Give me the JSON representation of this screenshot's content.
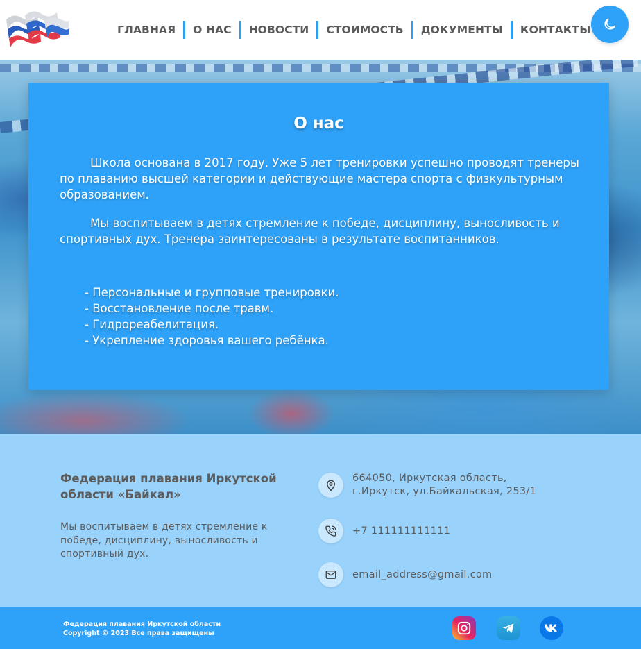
{
  "nav": {
    "items": [
      "ГЛАВНАЯ",
      "О НАС",
      "НОВОСТИ",
      "СТОИМОСТЬ",
      "ДОКУМЕНТЫ",
      "КОНТАКТЫ"
    ]
  },
  "icons": {
    "logo": "flag-logo-icon",
    "theme_toggle": "moon-icon",
    "address": "map-pin-icon",
    "phone": "phone-icon",
    "email": "mail-icon",
    "social": [
      "instagram-icon",
      "telegram-icon",
      "vk-icon"
    ]
  },
  "colors": {
    "accent": "#2ea2f8",
    "footer_bg": "#99d2fb",
    "text_muted": "#5c5c5c"
  },
  "about": {
    "title": "О нас",
    "paragraph1": "Школа основана в 2017 году. Уже 5 лет тренировки успешно проводят тренеры по плаванию высшей категории и действующие мастера спорта с физкультурным образованием.",
    "paragraph2": "Мы воспитываем в детях стремление к победе, дисциплину, выносливость и спортивных дух. Тренера заинтересованы в результате воспитанников.",
    "list": [
      "- Персональные и групповые тренировки.",
      "- Восстановление после травм.",
      "- Гидрореабелитация.",
      "- Укрепление здоровья вашего ребёнка."
    ]
  },
  "footer": {
    "org_title": "Федерация плавания Иркутской области «Байкал»",
    "org_description": "Мы воспитываем в детях стремление к победе, дисциплину, выносливость и спортивный дух.",
    "address_line1": "664050, Иркутская область,",
    "address_line2": "г.Иркутск, ул.Байкальская, 253/1",
    "phone": "+7 111111111111",
    "email": "email_address@gmail.com"
  },
  "bottom": {
    "line1": "Федерация плавания Иркутской области",
    "line2": "Copyright © 2023 Все права защищены"
  }
}
